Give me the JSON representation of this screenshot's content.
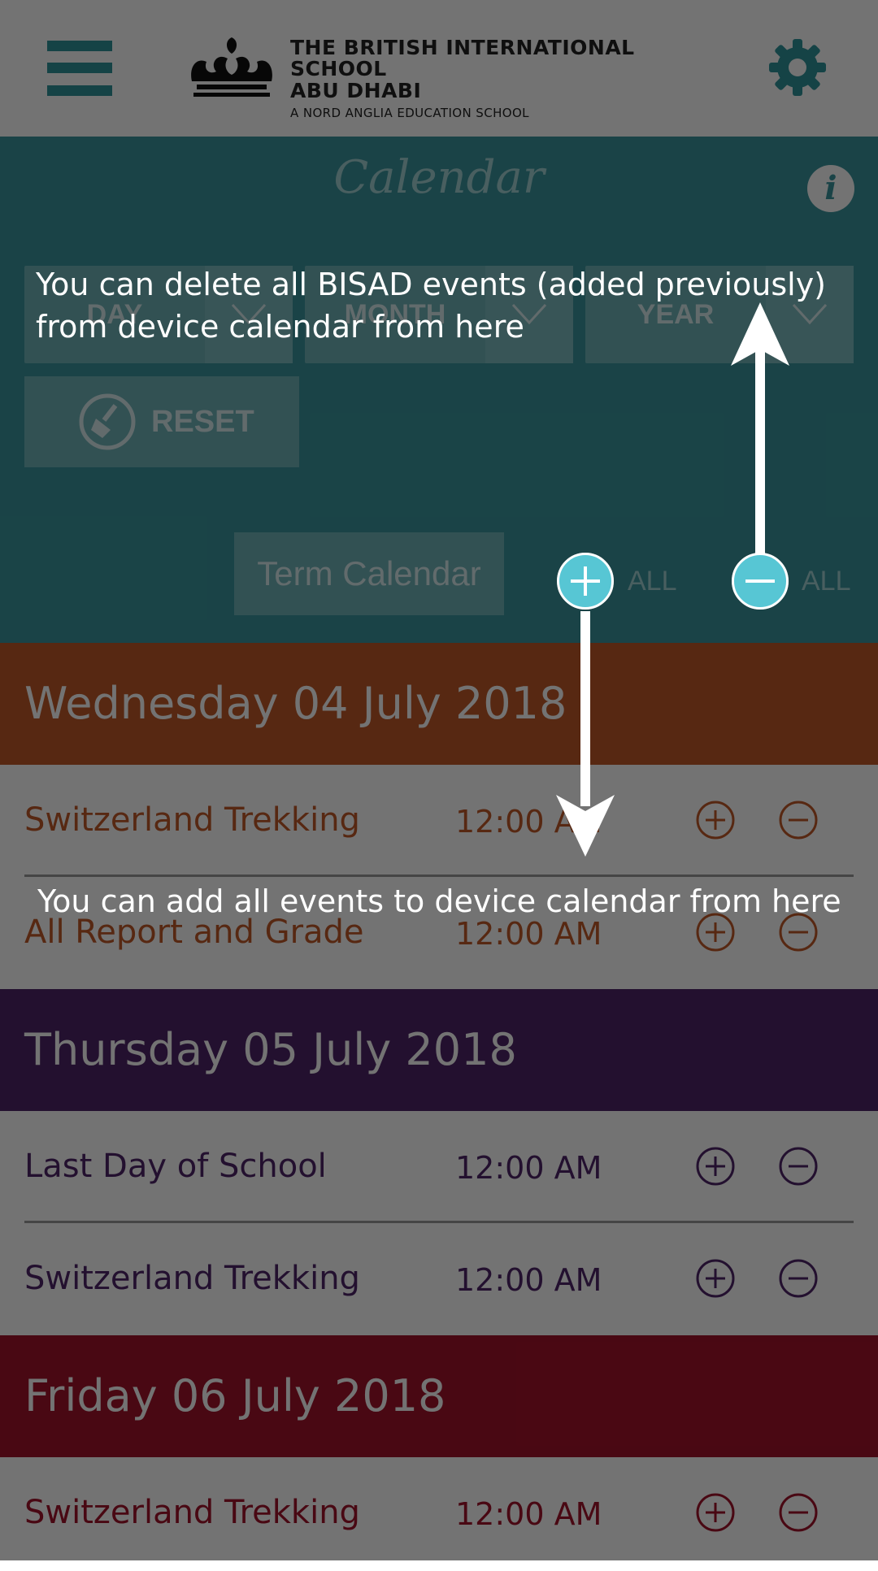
{
  "header": {
    "menu_icon": "hamburger-icon",
    "logo_line1": "THE BRITISH INTERNATIONAL SCHOOL",
    "logo_line2": "ABU DHABI",
    "logo_line3": "A NORD ANGLIA EDUCATION SCHOOL",
    "settings_icon": "gear-icon"
  },
  "calendar": {
    "title": "Calendar",
    "info_icon_glyph": "i",
    "filters": {
      "day_label": "DAY",
      "month_label": "MONTH",
      "year_label": "YEAR"
    },
    "reset_label": "RESET",
    "term_calendar_label": "Term Calendar",
    "add_all_label": "ALL",
    "remove_all_label": "ALL"
  },
  "days": [
    {
      "date": "Wednesday 04 July 2018",
      "color": "#c25a28",
      "events": [
        {
          "title": "Switzerland Trekking",
          "time": "12:00 AM"
        },
        {
          "title": "All Report and Grade",
          "time": "12:00 AM"
        }
      ]
    },
    {
      "date": "Thursday 05 July 2018",
      "color": "#4f2568",
      "events": [
        {
          "title": "Last Day of School",
          "time": "12:00 AM"
        },
        {
          "title": "Switzerland Trekking",
          "time": "12:00 AM"
        }
      ]
    },
    {
      "date": "Friday 06 July 2018",
      "color": "#a3122b",
      "events": [
        {
          "title": "Switzerland Trekking",
          "time": "12:00 AM"
        }
      ]
    }
  ],
  "tutorial": {
    "delete_tip_line1": "You can delete all BISAD events (added previously)",
    "delete_tip_line2": "from device calendar from here",
    "add_tip": "You can add all events to device calendar from here"
  },
  "colors": {
    "teal": "#3a969d",
    "accent_circle": "#57c6d4"
  }
}
